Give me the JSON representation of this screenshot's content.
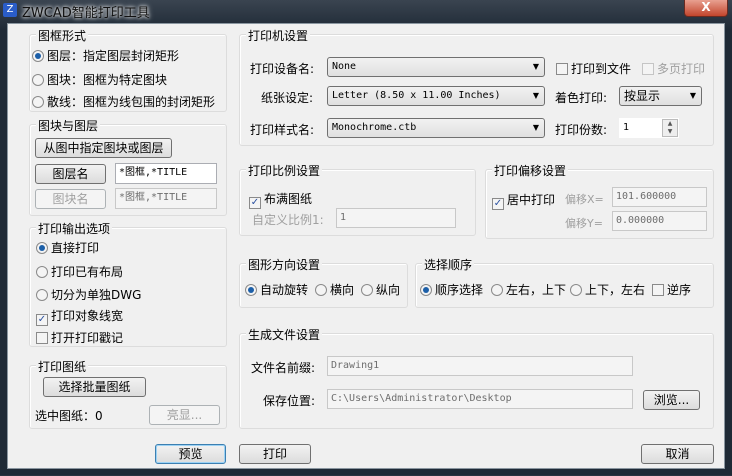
{
  "window": {
    "title": "ZWCAD智能打印工具",
    "close": "X"
  },
  "frame_style": {
    "legend": "图框形式",
    "options": [
      "图层：指定图层封闭矩形",
      "图块：图框为特定图块",
      "散线：图框为线包围的封闭矩形"
    ],
    "selected": 0
  },
  "block_layer": {
    "legend": "图块与图层",
    "pick_button": "从图中指定图块或图层",
    "layer_button": "图层名",
    "layer_value": "*图框,*TITLE",
    "block_button": "图块名",
    "block_value": "*图框,*TITLE"
  },
  "output": {
    "legend": "打印输出选项",
    "options": [
      "直接打印",
      "打印已有布局",
      "切分为单独DWG"
    ],
    "selected": 0,
    "checks": [
      {
        "label": "打印对象线宽",
        "checked": true
      },
      {
        "label": "打开打印戳记",
        "checked": false
      }
    ]
  },
  "sheets": {
    "legend": "打印图纸",
    "select_button": "选择批量图纸",
    "selected_label": "选中图纸：",
    "selected_count": "0",
    "highlight_button": "亮显..."
  },
  "printer": {
    "legend": "打印机设置",
    "device_label": "打印设备名:",
    "device_value": "None",
    "paper_label": "纸张设定:",
    "paper_value": "Letter (8.50 x 11.00 Inches)",
    "style_label": "打印样式名:",
    "style_value": "Monochrome.ctb",
    "to_file": "打印到文件",
    "multi_page": "多页打印",
    "color_label": "着色打印:",
    "color_value": "按显示",
    "copies_label": "打印份数:",
    "copies_value": "1"
  },
  "scale": {
    "legend": "打印比例设置",
    "fit": "布满图纸",
    "custom_label": "自定义比例1:",
    "custom_value": "1"
  },
  "offset": {
    "legend": "打印偏移设置",
    "center": "居中打印",
    "x_label": "偏移X=",
    "x_value": "101.600000",
    "y_label": "偏移Y=",
    "y_value": "0.000000"
  },
  "orientation": {
    "legend": "图形方向设置",
    "options": [
      "自动旋转",
      "横向",
      "纵向"
    ],
    "selected": 0
  },
  "order": {
    "legend": "选择顺序",
    "options": [
      "顺序选择",
      "左右，上下",
      "上下，左右"
    ],
    "selected": 0,
    "reverse": "逆序"
  },
  "file": {
    "legend": "生成文件设置",
    "prefix_label": "文件名前缀:",
    "prefix_value": "Drawing1",
    "path_label": "保存位置:",
    "path_value": "C:\\Users\\Administrator\\Desktop",
    "browse": "浏览..."
  },
  "footer": {
    "preview": "预览",
    "print": "打印",
    "cancel": "取消"
  }
}
